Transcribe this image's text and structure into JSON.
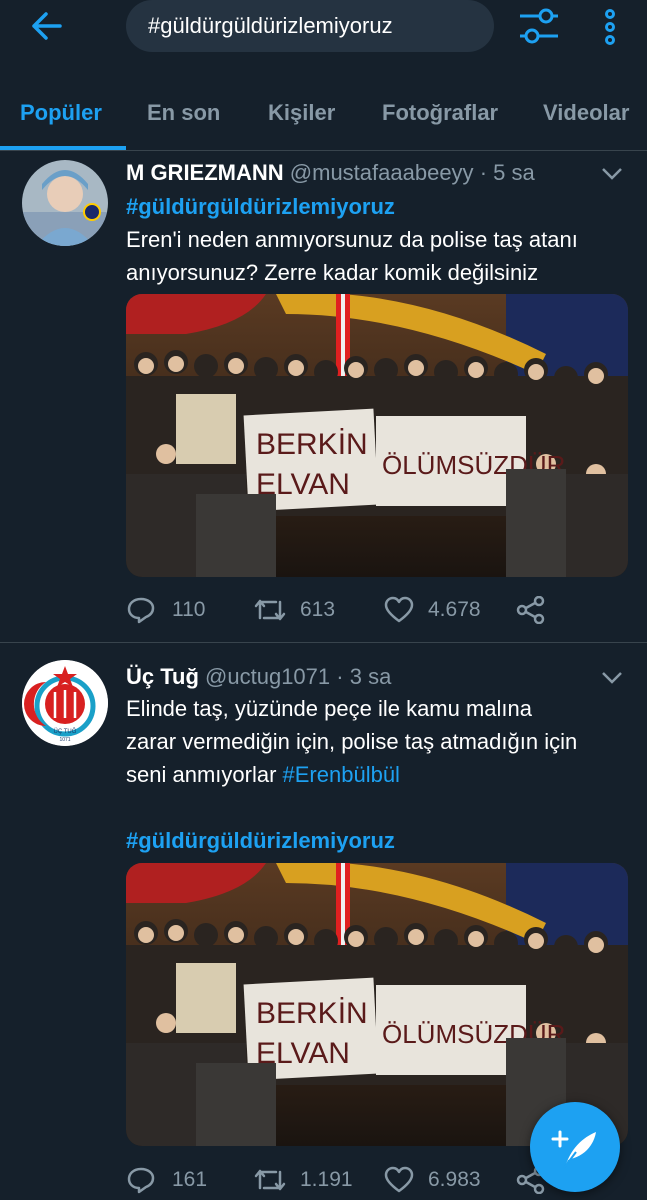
{
  "header": {
    "search_value": "#güldürgüldürizlemiyoruz",
    "icons": [
      "back-arrow-icon",
      "filter-sliders-icon",
      "more-vertical-icon"
    ]
  },
  "tabs": [
    {
      "label": "Popüler",
      "active": true
    },
    {
      "label": "En son",
      "active": false
    },
    {
      "label": "Kişiler",
      "active": false
    },
    {
      "label": "Fotoğraflar",
      "active": false
    },
    {
      "label": "Videolar",
      "active": false
    }
  ],
  "tweets": [
    {
      "name": "M GRIEZMANN",
      "handle": "@mustafaaabeeyy",
      "sep": "·",
      "time": "5 sa",
      "hashtag_top": "#güldürgüldürizlemiyoruz",
      "text_line1": "Eren'i neden anmıyorsunuz da polise taş atanı",
      "text_line2": "anıyorsunuz? Zerre kadar komik değilsiniz",
      "image_sign_1": "BERKİN",
      "image_sign_2": "ELVAN",
      "image_sign_3": "ÖLÜMSÜZDÜR",
      "replies": "110",
      "retweets": "613",
      "likes": "4.678"
    },
    {
      "name": "Üç Tuğ",
      "handle": "@uctug1071",
      "sep": "·",
      "time": "3 sa",
      "text_line1": "Elinde taş, yüzünde peçe ile kamu malına",
      "text_line2": "zarar vermediğin için, polise taş atmadığın için",
      "text_line3": "seni anmıyorlar ",
      "text_line3_tag": "#Erenbülbül",
      "hashtag_bottom": "#güldürgüldürizlemiyoruz",
      "avatar_text": "ÜÇ TUĞ",
      "avatar_year": "1071",
      "image_sign_1": "BERKİN",
      "image_sign_2": "ELVAN",
      "image_sign_3": "ÖLÜMSÜZDÜR",
      "replies": "161",
      "retweets": "1.191",
      "likes": "6.983"
    }
  ],
  "colors": {
    "background": "#15202b",
    "accent": "#1da1f2",
    "secondary_text": "#8899a6",
    "divider": "#38444d"
  }
}
